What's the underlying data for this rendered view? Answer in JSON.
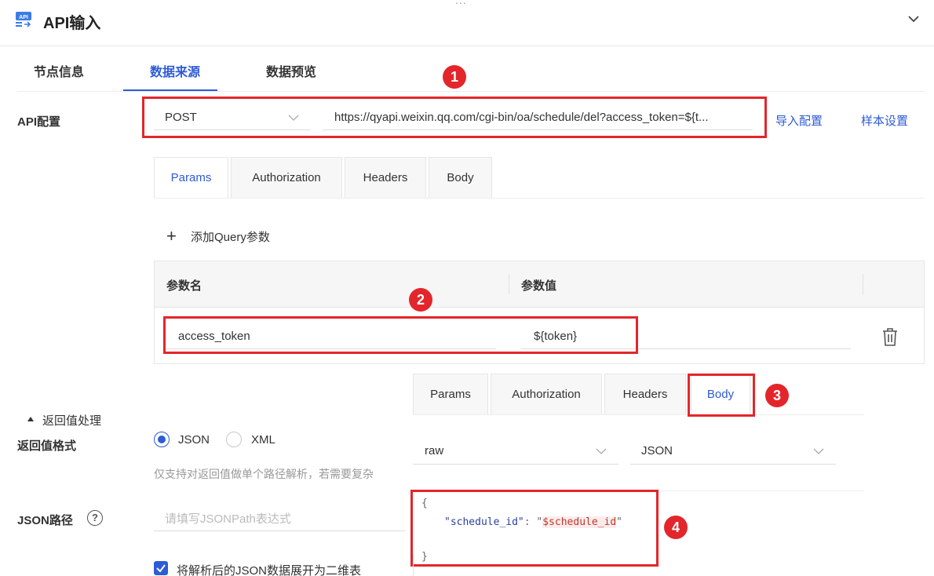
{
  "header": {
    "logo_text": "API",
    "title": "API输入",
    "top_dots": "..."
  },
  "main_tabs": [
    {
      "label": "节点信息"
    },
    {
      "label": "数据来源"
    },
    {
      "label": "数据预览"
    }
  ],
  "api_config": {
    "label": "API配置",
    "method": "POST",
    "url": "https://qyapi.weixin.qq.com/cgi-bin/oa/schedule/del?access_token=${t...",
    "import_link": "导入配置",
    "sample_link": "样本设置"
  },
  "request_tabs": [
    {
      "label": "Params"
    },
    {
      "label": "Authorization"
    },
    {
      "label": "Headers"
    },
    {
      "label": "Body"
    }
  ],
  "params": {
    "add_label": "添加Query参数",
    "columns": [
      "参数名",
      "参数值"
    ],
    "rows": [
      {
        "name": "access_token",
        "value": "${token}"
      }
    ]
  },
  "overlay_tabs": [
    {
      "label": "Params"
    },
    {
      "label": "Authorization"
    },
    {
      "label": "Headers"
    },
    {
      "label": "Body"
    }
  ],
  "body": {
    "mode": "raw",
    "format": "JSON",
    "code": {
      "open": "{",
      "key": "\"schedule_id\"",
      "colon": ": ",
      "quote_open": "\"",
      "value": "$schedule_id",
      "quote_close": "\"",
      "close": "}"
    }
  },
  "return": {
    "section_label": "返回值处理",
    "format_label": "返回值格式",
    "options": [
      "JSON",
      "XML"
    ],
    "selected": "JSON",
    "hint": "仅支持对返回值做单个路径解析，若需要复杂"
  },
  "json_path": {
    "label": "JSON路径",
    "help": "?",
    "placeholder": "请填写JSONPath表达式"
  },
  "expand": {
    "label": "将解析后的JSON数据展开为二维表",
    "checked": true
  },
  "annotations": [
    "1",
    "2",
    "3",
    "4"
  ],
  "colors": {
    "accent": "#2e5bd6",
    "annotation_red": "#e3262b"
  }
}
